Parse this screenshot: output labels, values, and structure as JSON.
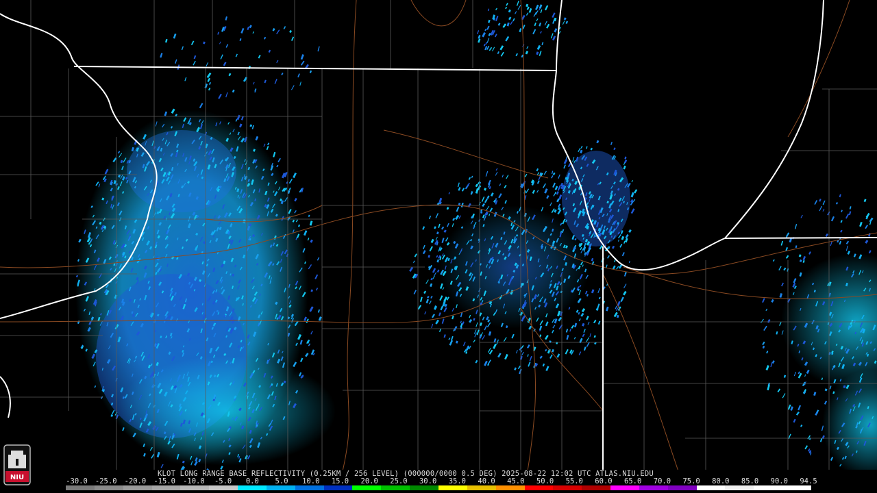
{
  "radar": {
    "site": "KLOT",
    "title_line": "KLOT LONG RANGE BASE REFLECTIVITY (0.25KM / 256 LEVEL) (000000/0000 0.5 DEG) 2025-08-22 12:02 UTC  ATLAS.NIU.EDU",
    "timestamp": "2025-08-22 12:02 UTC",
    "source": "ATLAS.NIU.EDU"
  },
  "colorbar": {
    "tick_labels": [
      "-30.0",
      "-25.0",
      "-20.0",
      "-15.0",
      "-10.0",
      "-5.0",
      "0.0",
      "5.0",
      "10.0",
      "15.0",
      "20.0",
      "25.0",
      "30.0",
      "35.0",
      "40.0",
      "45.0",
      "50.0",
      "55.0",
      "60.0",
      "65.0",
      "70.0",
      "75.0",
      "80.0",
      "85.0",
      "90.0",
      "94.5"
    ],
    "colors": [
      "#7a7a7a",
      "#8a8a8a",
      "#9a9a9a",
      "#a8a8a8",
      "#b8b8b8",
      "#c8c8c8",
      "#00e8ff",
      "#00b0f0",
      "#0070e0",
      "#0030c0",
      "#00ff00",
      "#00c000",
      "#008800",
      "#ffff00",
      "#e8c000",
      "#ff9000",
      "#ff0000",
      "#d80000",
      "#b00000",
      "#ff00ff",
      "#a000e0",
      "#8000c0",
      "#ffffff",
      "#f0f0f0",
      "#ffffff",
      "#ffffff"
    ]
  },
  "logo": {
    "text": "NIU"
  }
}
